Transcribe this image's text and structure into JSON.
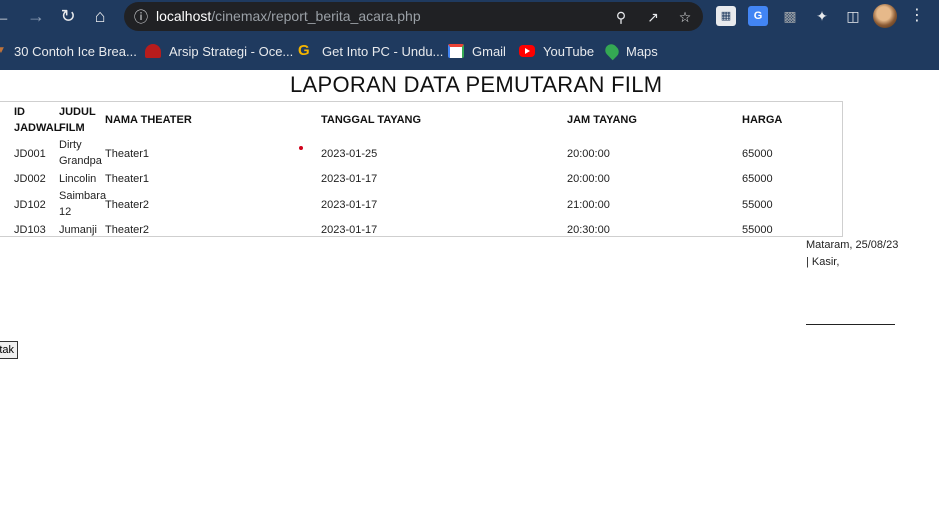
{
  "browser": {
    "url_host": "localhost",
    "url_path": "/cinemax/report_berita_acara.php",
    "bookmarks": [
      {
        "label": "30 Contoh Ice Brea...",
        "color": "#c0733a"
      },
      {
        "label": "Arsip Strategi - Oce...",
        "color": "#b71c1c"
      },
      {
        "label": "Get Into PC - Undu...",
        "color": "#f4b400"
      },
      {
        "label": "Gmail",
        "color": "#ea4335"
      },
      {
        "label": "YouTube",
        "color": "#ff0000"
      },
      {
        "label": "Maps",
        "color": "#34a853"
      }
    ]
  },
  "report": {
    "title": "LAPORAN DATA PEMUTARAN FILM",
    "columns": {
      "id_line1": "ID",
      "id_line2": "JADWAL",
      "judul_line1": "JUDUL",
      "judul_line2": "FILM",
      "theater": "NAMA THEATER",
      "tanggal": "TANGGAL TAYANG",
      "jam": "JAM TAYANG",
      "harga": "HARGA"
    },
    "rows": [
      {
        "id": "JD001",
        "judul_1": "Dirty",
        "judul_2": "Grandpa",
        "theater": "Theater1",
        "tanggal": "2023-01-25",
        "jam": "20:00:00",
        "harga": "65000"
      },
      {
        "id": "JD002",
        "judul_1": "Lincolin",
        "judul_2": "",
        "theater": "Theater1",
        "tanggal": "2023-01-17",
        "jam": "20:00:00",
        "harga": "65000"
      },
      {
        "id": "JD102",
        "judul_1": "Saimbara",
        "judul_2": "12",
        "theater": "Theater2",
        "tanggal": "2023-01-17",
        "jam": "21:00:00",
        "harga": "55000"
      },
      {
        "id": "JD103",
        "judul_1": "Jumanji",
        "judul_2": "",
        "theater": "Theater2",
        "tanggal": "2023-01-17",
        "jam": "20:30:00",
        "harga": "55000"
      }
    ],
    "signature": {
      "place_date": "Mataram, 25/08/23",
      "role": "| Kasir,"
    },
    "print_button": "tak"
  }
}
